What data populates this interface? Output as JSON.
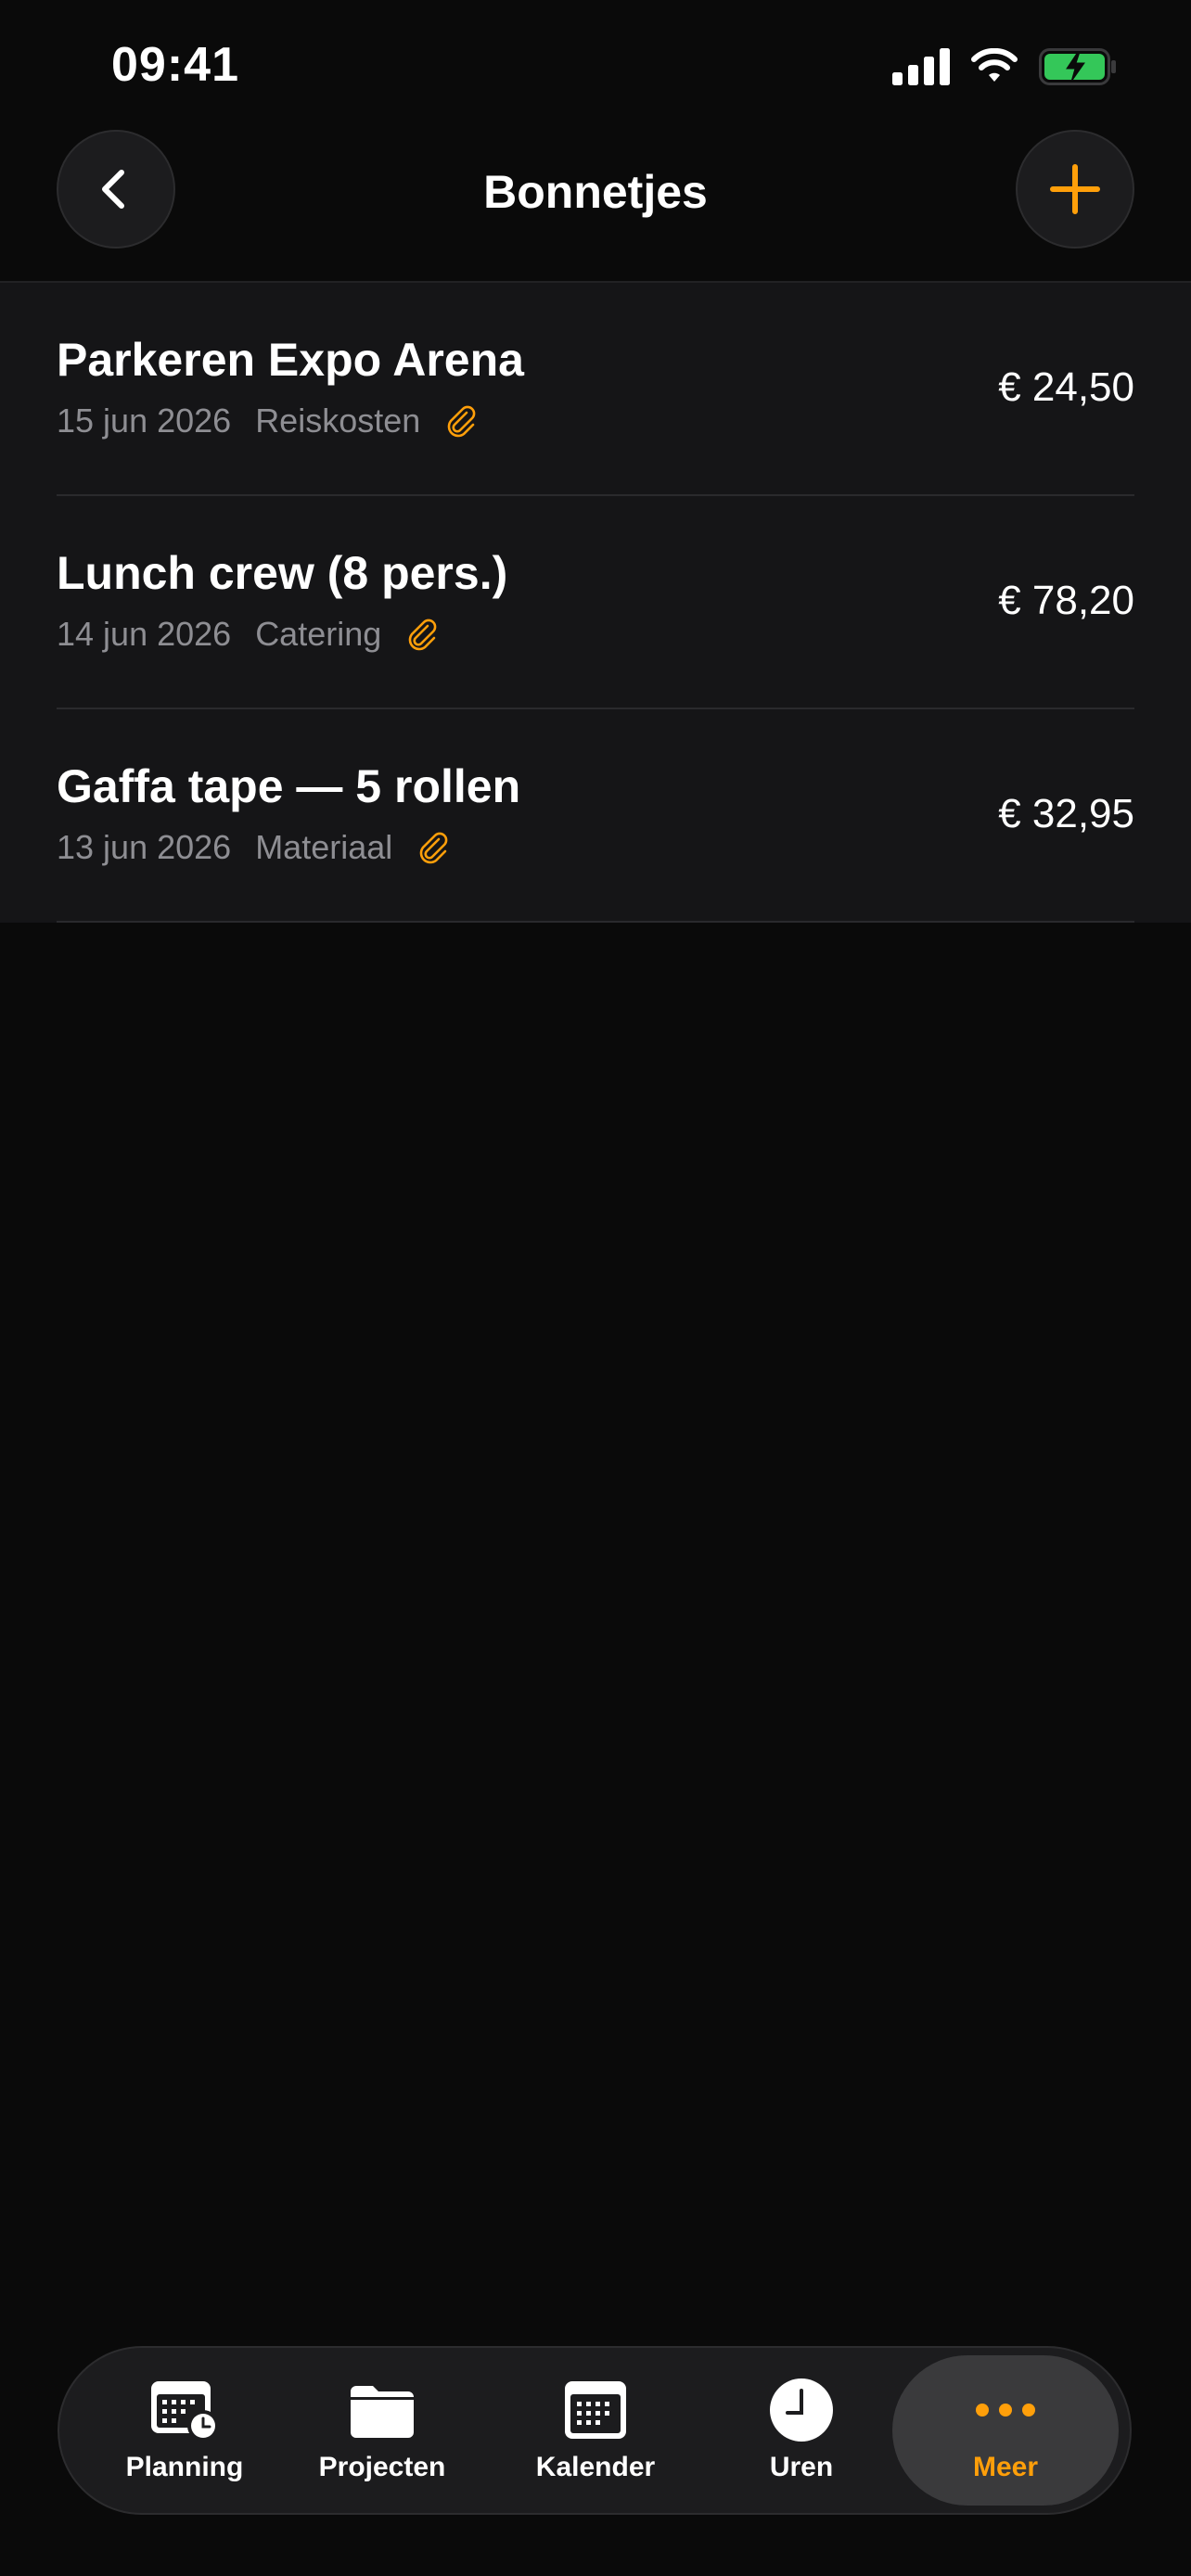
{
  "status_bar": {
    "time": "09:41"
  },
  "nav": {
    "title": "Bonnetjes",
    "back_icon": "chevron-left-icon",
    "add_icon": "plus-icon"
  },
  "colors": {
    "accent": "#ff9f0a",
    "background": "#0a0a0a",
    "row_background": "#151517",
    "secondary_text": "#8e8e93",
    "battery_green": "#34c759"
  },
  "receipts": [
    {
      "title": "Parkeren Expo Arena",
      "date": "15 jun 2026",
      "category": "Reiskosten",
      "amount": "€ 24,50",
      "has_attachment": true
    },
    {
      "title": "Lunch crew (8 pers.)",
      "date": "14 jun 2026",
      "category": "Catering",
      "amount": "€ 78,20",
      "has_attachment": true
    },
    {
      "title": "Gaffa tape — 5 rollen",
      "date": "13 jun 2026",
      "category": "Materiaal",
      "amount": "€ 32,95",
      "has_attachment": true
    }
  ],
  "tab_bar": {
    "items": [
      {
        "label": "Planning",
        "icon": "calendar-clock-icon",
        "active": false
      },
      {
        "label": "Projecten",
        "icon": "folder-icon",
        "active": false
      },
      {
        "label": "Kalender",
        "icon": "calendar-icon",
        "active": false
      },
      {
        "label": "Uren",
        "icon": "clock-icon",
        "active": false
      },
      {
        "label": "Meer",
        "icon": "more-dots-icon",
        "active": true
      }
    ]
  }
}
